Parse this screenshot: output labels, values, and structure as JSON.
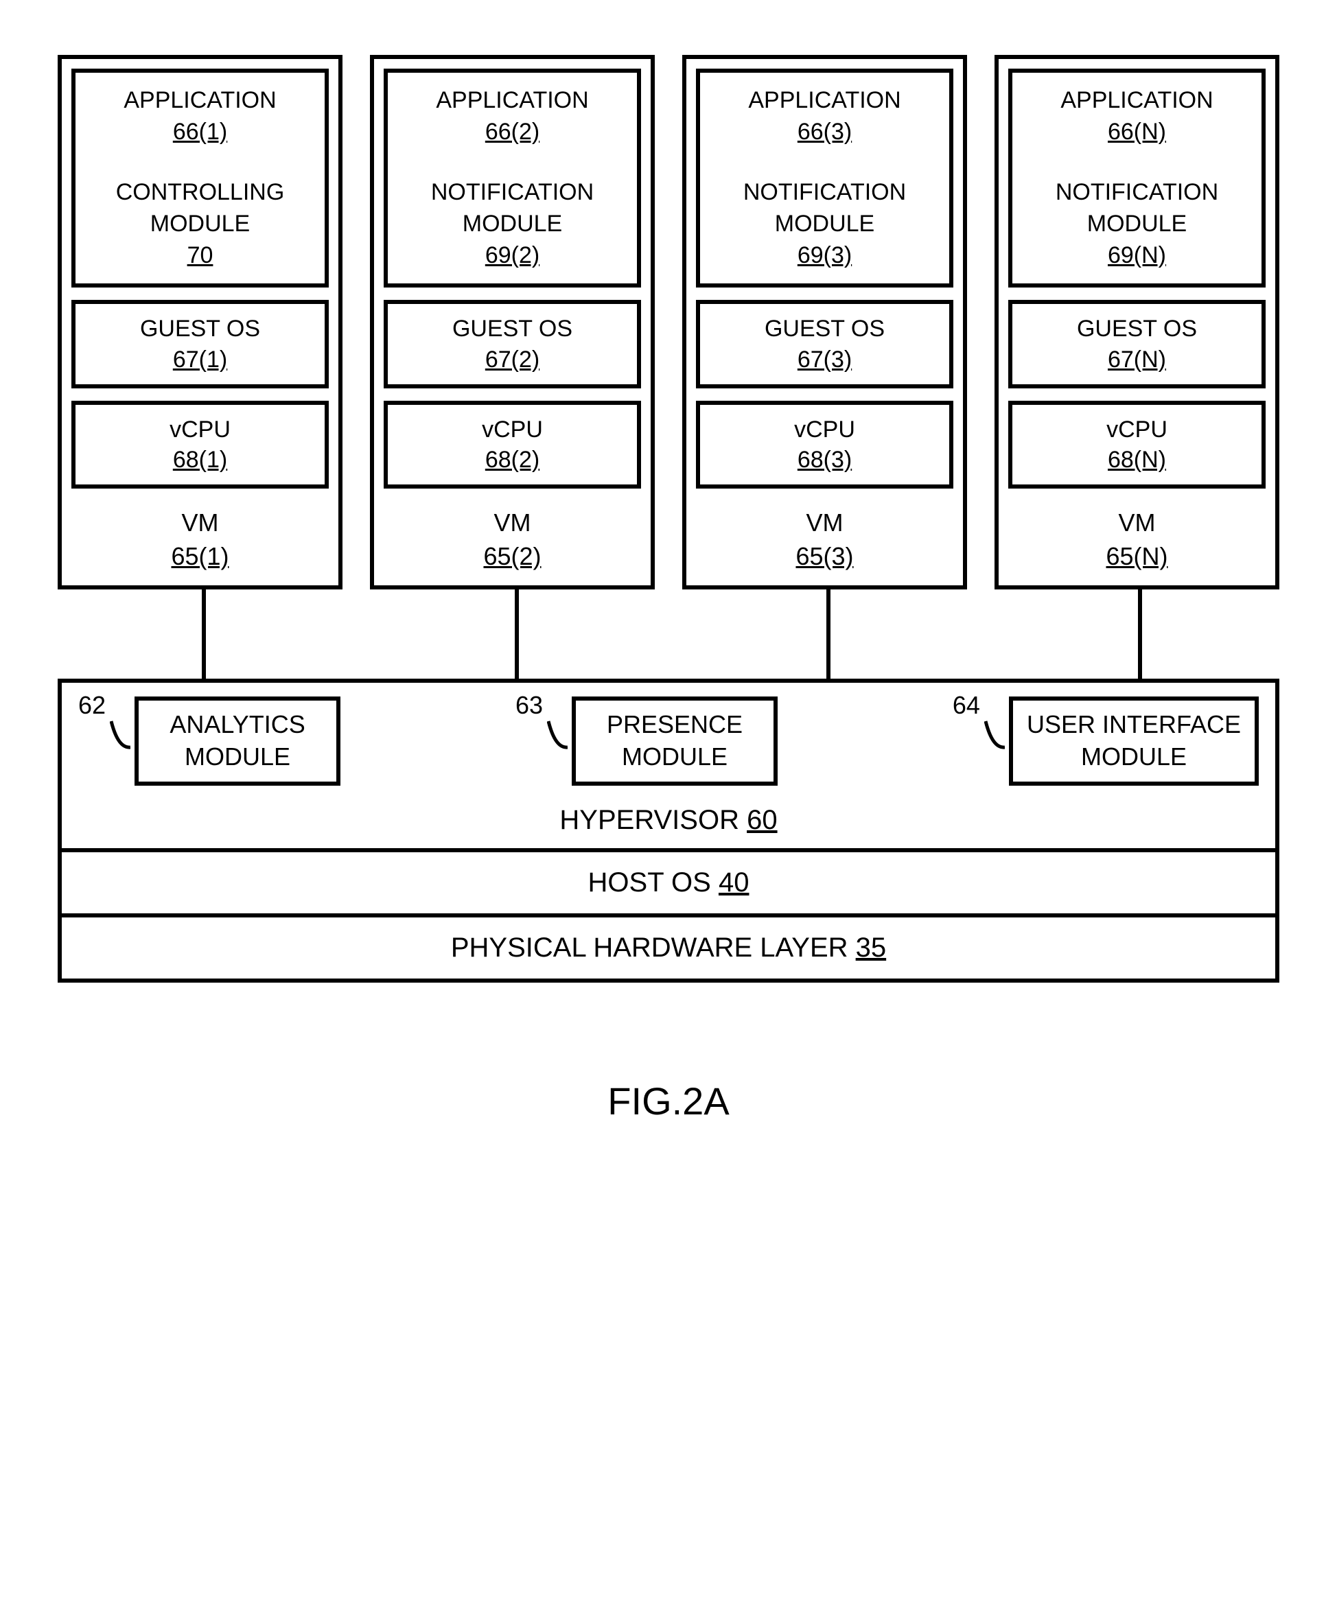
{
  "vms": [
    {
      "app_label": "APPLICATION",
      "app_ref": "66(1)",
      "mod_label_1": "CONTROLLING",
      "mod_label_2": "MODULE",
      "mod_ref": "70",
      "os_label": "GUEST OS",
      "os_ref": "67(1)",
      "vcpu_label": "vCPU",
      "vcpu_ref": "68(1)",
      "vm_label": "VM",
      "vm_ref": "65(1)"
    },
    {
      "app_label": "APPLICATION",
      "app_ref": "66(2)",
      "mod_label_1": "NOTIFICATION",
      "mod_label_2": "MODULE",
      "mod_ref": "69(2)",
      "os_label": "GUEST OS",
      "os_ref": "67(2)",
      "vcpu_label": "vCPU",
      "vcpu_ref": "68(2)",
      "vm_label": "VM",
      "vm_ref": "65(2)"
    },
    {
      "app_label": "APPLICATION",
      "app_ref": "66(3)",
      "mod_label_1": "NOTIFICATION",
      "mod_label_2": "MODULE",
      "mod_ref": "69(3)",
      "os_label": "GUEST OS",
      "os_ref": "67(3)",
      "vcpu_label": "vCPU",
      "vcpu_ref": "68(3)",
      "vm_label": "VM",
      "vm_ref": "65(3)"
    },
    {
      "app_label": "APPLICATION",
      "app_ref": "66(N)",
      "mod_label_1": "NOTIFICATION",
      "mod_label_2": "MODULE",
      "mod_ref": "69(N)",
      "os_label": "GUEST OS",
      "os_ref": "67(N)",
      "vcpu_label": "vCPU",
      "vcpu_ref": "68(N)",
      "vm_label": "VM",
      "vm_ref": "65(N)"
    }
  ],
  "hypervisor": {
    "modules": [
      {
        "num": "62",
        "line1": "ANALYTICS",
        "line2": "MODULE"
      },
      {
        "num": "63",
        "line1": "PRESENCE",
        "line2": "MODULE"
      },
      {
        "num": "64",
        "line1": "USER INTERFACE",
        "line2": "MODULE"
      }
    ],
    "title_label": "HYPERVISOR",
    "title_ref": "60"
  },
  "host_os": {
    "label": "HOST OS",
    "ref": "40"
  },
  "hw": {
    "label": "PHYSICAL HARDWARE LAYER",
    "ref": "35"
  },
  "figure_label": "FIG.2A"
}
